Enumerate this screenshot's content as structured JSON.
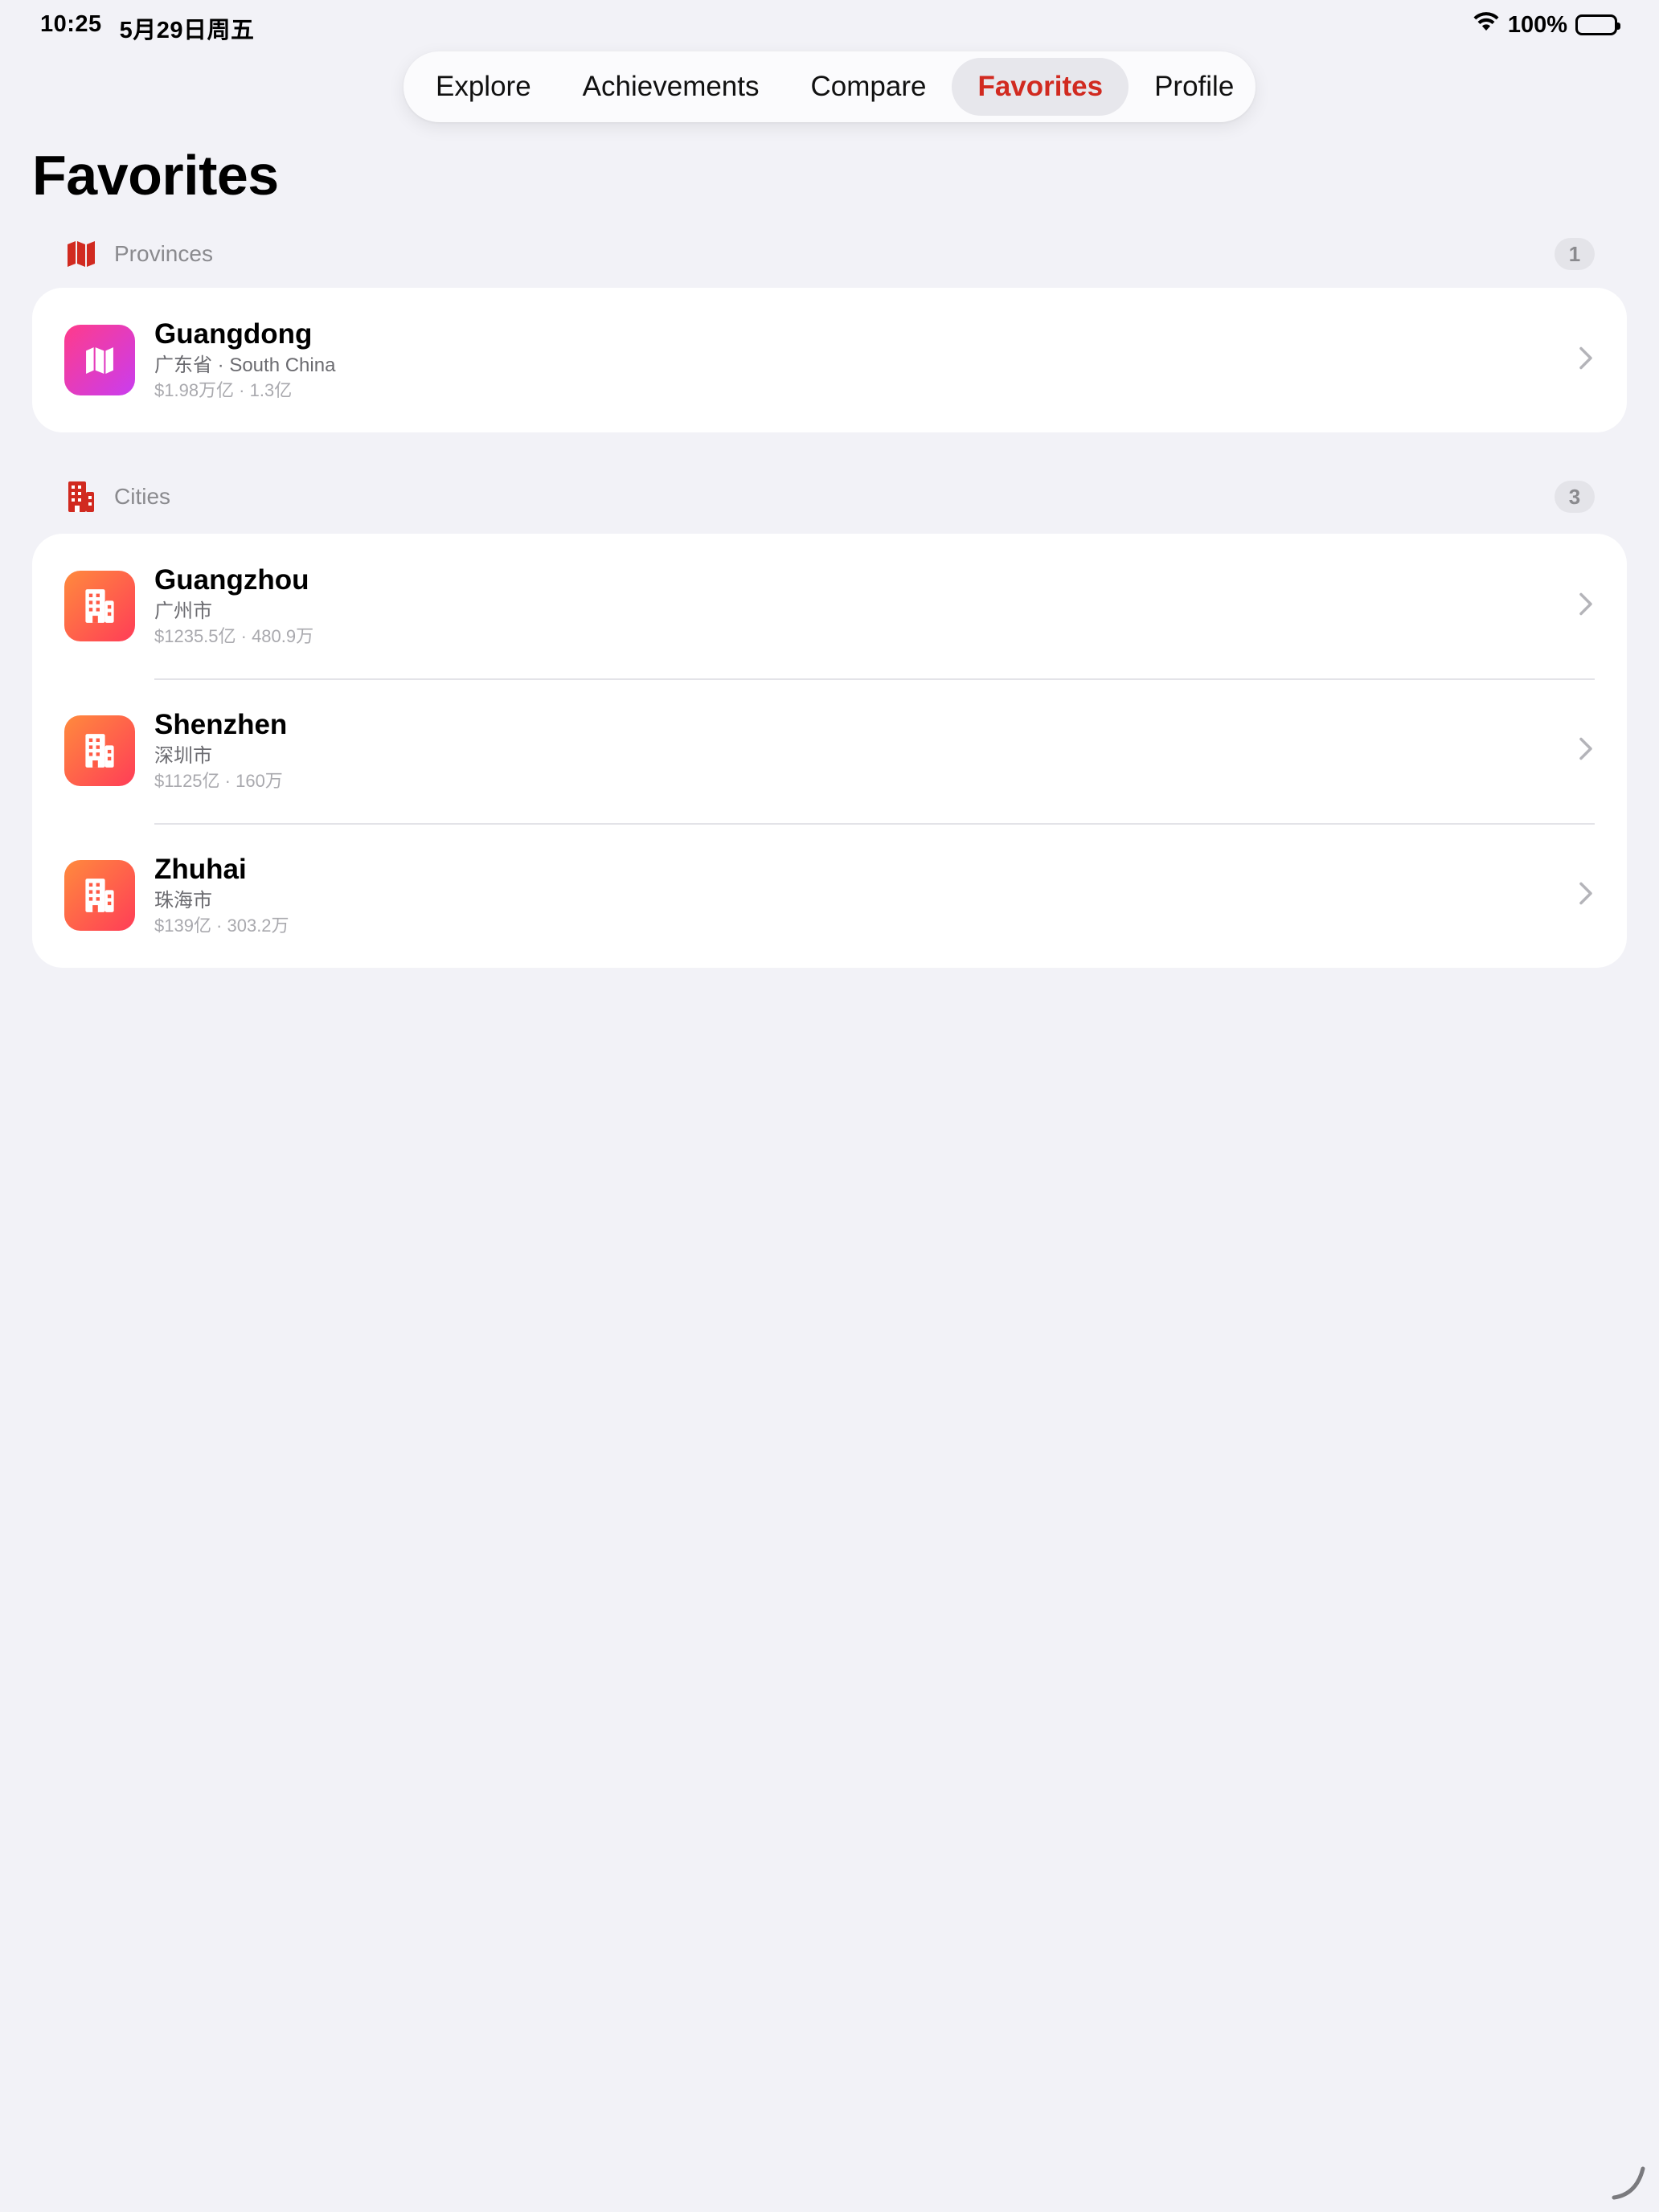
{
  "status": {
    "time": "10:25",
    "date": "5月29日周五",
    "battery": "100%",
    "wifi_icon": "wifi-icon",
    "battery_icon": "battery-icon"
  },
  "tabs": [
    {
      "label": "Explore",
      "active": false
    },
    {
      "label": "Achievements",
      "active": false
    },
    {
      "label": "Compare",
      "active": false
    },
    {
      "label": "Favorites",
      "active": true
    },
    {
      "label": "Profile",
      "active": false
    }
  ],
  "page_title": "Favorites",
  "colors": {
    "accent": "#d12a20",
    "background": "#f2f2f7",
    "province_gradient": [
      "#ff3b8a",
      "#c93df0"
    ],
    "city_gradient": [
      "#ff8a3d",
      "#ff3d57"
    ]
  },
  "provinces": {
    "label": "Provinces",
    "count": "1",
    "icon": "map-icon",
    "items": [
      {
        "name": "Guangdong",
        "subtitle": "广东省 · South China",
        "meta": "$1.98万亿 · 1.3亿"
      }
    ]
  },
  "cities": {
    "label": "Cities",
    "count": "3",
    "icon": "building-icon",
    "items": [
      {
        "name": "Guangzhou",
        "subtitle": "广州市",
        "meta": "$1235.5亿 · 480.9万"
      },
      {
        "name": "Shenzhen",
        "subtitle": "深圳市",
        "meta": "$1125亿 · 160万"
      },
      {
        "name": "Zhuhai",
        "subtitle": "珠海市",
        "meta": "$139亿 · 303.2万"
      }
    ]
  }
}
